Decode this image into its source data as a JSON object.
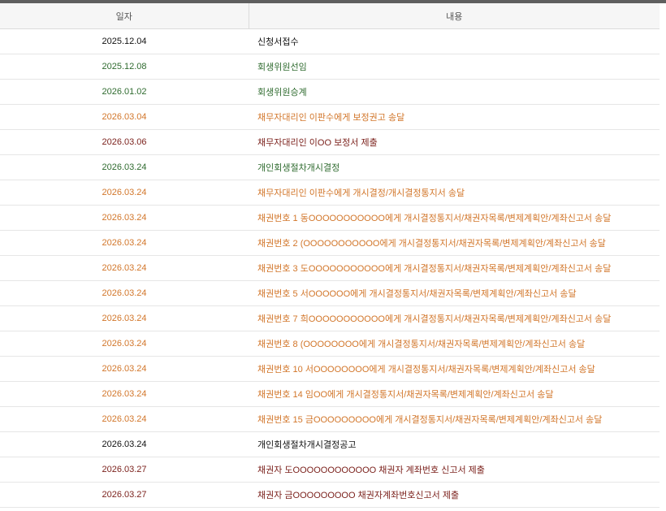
{
  "table": {
    "headers": {
      "date": "일자",
      "content": "내용"
    },
    "colors": {
      "black": "#111111",
      "green": "#2f6b2f",
      "orange": "#d2762a",
      "maroon": "#7a1f1a"
    },
    "rows": [
      {
        "date": "2025.12.04",
        "content": "신청서접수",
        "status": "black"
      },
      {
        "date": "2025.12.08",
        "content": "회생위원선임",
        "status": "green"
      },
      {
        "date": "2026.01.02",
        "content": "회생위원승계",
        "status": "green"
      },
      {
        "date": "2026.03.04",
        "content": "채무자대리인 이판수에게 보정권고 송달",
        "status": "orange"
      },
      {
        "date": "2026.03.06",
        "content": "채무자대리인 이OO 보정서 제출",
        "status": "maroon"
      },
      {
        "date": "2026.03.24",
        "content": "개인회생절차개시결정",
        "status": "green"
      },
      {
        "date": "2026.03.24",
        "content": "채무자대리인 이판수에게 개시결정/개시결정통지서 송달",
        "status": "orange"
      },
      {
        "date": "2026.03.24",
        "content": "채권번호 1 동OOOOOOOOOOO에게 개시결정통지서/채권자목록/변제계획안/계좌신고서 송달",
        "status": "orange"
      },
      {
        "date": "2026.03.24",
        "content": "채권번호 2 (OOOOOOOOOOO에게 개시결정통지서/채권자목록/변제계획안/계좌신고서 송달",
        "status": "orange"
      },
      {
        "date": "2026.03.24",
        "content": "채권번호 3 도OOOOOOOOOOO에게 개시결정통지서/채권자목록/변제계획안/계좌신고서 송달",
        "status": "orange"
      },
      {
        "date": "2026.03.24",
        "content": "채권번호 5 서OOOOOO에게 개시결정통지서/채권자목록/변제계획안/계좌신고서 송달",
        "status": "orange"
      },
      {
        "date": "2026.03.24",
        "content": "채권번호 7 희OOOOOOOOOOO에게 개시결정통지서/채권자목록/변제계획안/계좌신고서 송달",
        "status": "orange"
      },
      {
        "date": "2026.03.24",
        "content": "채권번호 8 (OOOOOOOO에게 개시결정통지서/채권자목록/변제계획안/계좌신고서 송달",
        "status": "orange"
      },
      {
        "date": "2026.03.24",
        "content": "채권번호 10 서OOOOOOOO에게 개시결정통지서/채권자목록/변제계획안/계좌신고서 송달",
        "status": "orange"
      },
      {
        "date": "2026.03.24",
        "content": "채권번호 14 임OO에게 개시결정통지서/채권자목록/변제계획안/계좌신고서 송달",
        "status": "orange"
      },
      {
        "date": "2026.03.24",
        "content": "채권번호 15 금OOOOOOOOO에게 개시결정통지서/채권자목록/변제계획안/계좌신고서 송달",
        "status": "orange"
      },
      {
        "date": "2026.03.24",
        "content": "개인회생절차개시결정공고",
        "status": "black"
      },
      {
        "date": "2026.03.27",
        "content": "채권자 도OOOOOOOOOOOO 채권자 계좌번호 신고서 제출",
        "status": "maroon"
      },
      {
        "date": "2026.03.27",
        "content": "채권자 금OOOOOOOOO 채권자계좌번호신고서 제출",
        "status": "maroon"
      }
    ]
  }
}
